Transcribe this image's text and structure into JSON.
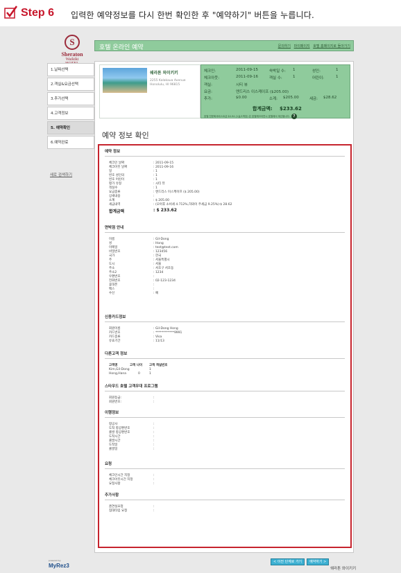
{
  "instruction": {
    "step_label": "Step 6",
    "description": "입력한 예약정보를 다시 한번 확인한 후 \"예약하기\" 버튼을 누릅니다."
  },
  "brand": {
    "logo_letter": "S",
    "name": "Sheraton",
    "sub": "Waikiki",
    "sub2": "HOTEL"
  },
  "header": {
    "title": "호텔 온라인 예약",
    "links": [
      "문의하기",
      "마이페이지",
      "호텔 홈페이지로 돌아가기"
    ]
  },
  "nav": {
    "items": [
      "1.날짜선택",
      "2.객실&요금선택",
      "3.추가선택",
      "4.고객정보",
      "5. 예약확인",
      "6.예약완료"
    ],
    "active_index": 4,
    "new_search": "새로 검색하기"
  },
  "hotel": {
    "name": "쉐라톤 와이키키",
    "address_line1": "2255 Kalakaua Avenue",
    "address_line2": "Honolulu, HI 96815"
  },
  "summary": {
    "checkin_label": "체크인:",
    "checkin": "2011-09-15",
    "nights_label": "숙박일 수:",
    "nights": "1",
    "adults_label": "성인:",
    "adults": "1",
    "checkout_label": "체크아웃:",
    "checkout": "2011-09-16",
    "rooms_label": "객실 수:",
    "rooms": "1",
    "children_label": "어린이:",
    "children": "1",
    "room_label": "객실:",
    "room": "시티 뷰",
    "rate_label": "요금:",
    "rate": "엔드리스 이스케이프 ($205.00)",
    "extra_label": "추가:",
    "extra": "$0.00",
    "subtotal_label": "소계:",
    "subtotal": "$205.00",
    "tax_label": "세금:",
    "tax": "$28.62",
    "total_label": "합계금액:",
    "total": "$233.62",
    "note": "호텔 전문화서비스요금 $0.94 (1실/1박당) 은 호텔체크아웃시 호텔에서 계산됩니다."
  },
  "page_title": "예약 정보 확인",
  "reservation": {
    "title": "예약 정보",
    "rows": [
      [
        "체크인 날짜",
        ": 2011-09-15"
      ],
      [
        "체크아웃 날짜",
        ": 2011-09-16"
      ],
      [
        "일",
        ": 1"
      ],
      [
        "번호 성인의",
        ": 1"
      ],
      [
        "번호 어린이",
        ": 1"
      ],
      [
        "평가 유형",
        ": 시티 뷰"
      ],
      [
        "객실수",
        ": 1"
      ],
      [
        "요금종류",
        ": 엔드리스 이스케이프 ($ 205.00)"
      ],
      [
        "상세내용",
        ":"
      ],
      [
        "소계",
        ": $ 205.00"
      ],
      [
        "세금내역",
        ": (오아후 소비세 4.712%,하와이 주세금 9.25%):$ 28.62"
      ]
    ],
    "total_label": "합계금액",
    "total_value": ": $ 233.62"
  },
  "guest": {
    "title": "면박점 안내",
    "rows": [
      [
        "이름",
        ": Gil-Dong"
      ],
      [
        "성",
        ": Hong"
      ],
      [
        "이메일",
        ": test@test.com"
      ],
      [
        "비밀번호",
        ": 123456"
      ],
      [
        "국가",
        ": 한국"
      ],
      [
        "주",
        ": 서울특별시"
      ],
      [
        "도시",
        ": 서울"
      ],
      [
        "주소",
        ": 서초구 서초동"
      ],
      [
        "주소2",
        ": 1234"
      ],
      [
        "우편번호",
        ":"
      ],
      [
        "전화번호",
        ": 02-123-1234"
      ],
      [
        "휴대폰",
        ":"
      ],
      [
        "팩스",
        ":"
      ],
      [
        "수신",
        ": 예"
      ]
    ]
  },
  "card": {
    "title": "신용카드정보",
    "rows": [
      [
        "회원이름",
        ": Gil-Dong Hong"
      ],
      [
        "카드번호",
        ": ************9991"
      ],
      [
        "카드종류",
        ": Visa"
      ],
      [
        "유효기간",
        ": 11/13"
      ]
    ]
  },
  "others": {
    "title": "다른고객 정보",
    "headers": [
      "고객명",
      "고객 나이",
      "고객 객실번호"
    ],
    "rows": [
      [
        "Kim,Gil-Dong",
        "",
        "1"
      ],
      [
        "Hong,Hana",
        "0",
        "1"
      ]
    ]
  },
  "loyalty": {
    "title": "스타우드 호텔 고객우대 프로그램",
    "rows": [
      [
        "회원등급:",
        ":"
      ],
      [
        "회원번호:",
        ":"
      ]
    ]
  },
  "travel": {
    "title": "이행정보",
    "rows": [
      [
        "항공사",
        ":"
      ],
      [
        "도착 항공편번호",
        ":"
      ],
      [
        "출발 항공편번호",
        ":"
      ],
      [
        "도착시간",
        ":"
      ],
      [
        "출발시간",
        ":"
      ],
      [
        "도착일",
        ":"
      ],
      [
        "출발일",
        ":"
      ]
    ]
  },
  "requests": {
    "title": "요청",
    "rows": [
      [
        "체크인시간 지정",
        ":"
      ],
      [
        "체크아웃시간 지정",
        ":"
      ],
      [
        "요청사항",
        ":"
      ]
    ]
  },
  "additional": {
    "title": "추가사항",
    "rows": [
      [
        "흡연실요청",
        ":"
      ],
      [
        "침대타입 요청",
        ":"
      ]
    ]
  },
  "buttons": {
    "prev": "< 이전 단계로 가기",
    "book": "예약하기 >"
  },
  "footer": {
    "powered": "powered by",
    "brand": "MyRez3",
    "hotel": "쉐라톤 와이키키"
  }
}
